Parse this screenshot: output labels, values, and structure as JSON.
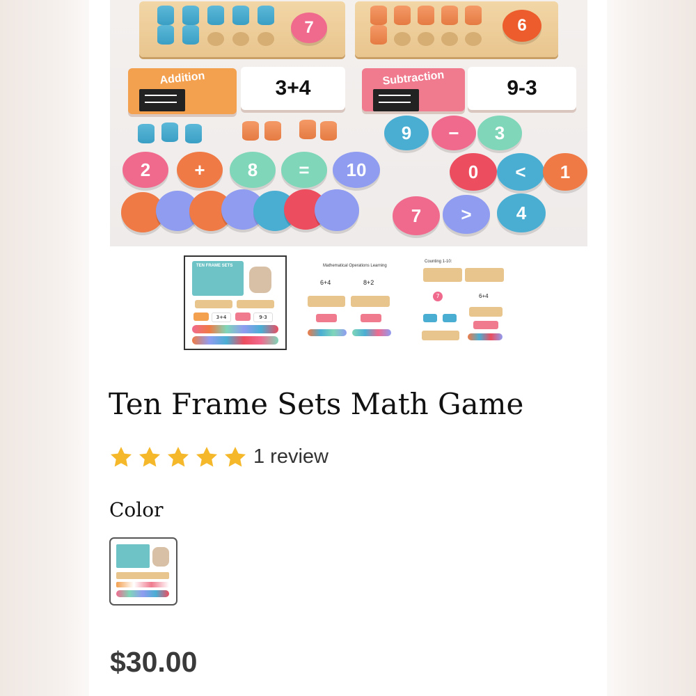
{
  "product": {
    "title": "Ten Frame Sets Math Game",
    "rating_stars": 5,
    "review_count_text": "1 review",
    "price": "$30.00"
  },
  "variant": {
    "label": "Color"
  },
  "hero": {
    "board_left_number": "7",
    "board_right_number": "6",
    "card_addition": "Addition",
    "card_addition_equation": "3+4",
    "card_subtraction": "Subtraction",
    "card_subtraction_equation": "9-3",
    "disc_row1": [
      "9",
      "−",
      "3"
    ],
    "disc_row2": [
      "2",
      "+",
      "8",
      "=",
      "10"
    ],
    "disc_row2_right": [
      "0",
      "<",
      "1"
    ],
    "disc_row3": [
      "7",
      ">",
      "4"
    ]
  },
  "thumbnails": [
    {
      "caption": "TEN FRAME SETS",
      "card_a": "3+4",
      "card_b": "9-3"
    },
    {
      "caption": "Mathematical Operations Learning",
      "card_a": "6+4",
      "card_b": "8+2"
    },
    {
      "caption": "Counting 1-10:",
      "card_a": "6+4",
      "node": "7"
    }
  ],
  "colors": {
    "blue": "#4aaed3",
    "orange": "#f07a45",
    "pink": "#f06a8e",
    "mint": "#7fd6b9",
    "lavender": "#8f9cf0",
    "red": "#ec4d5f",
    "star": "#f5b82a"
  }
}
